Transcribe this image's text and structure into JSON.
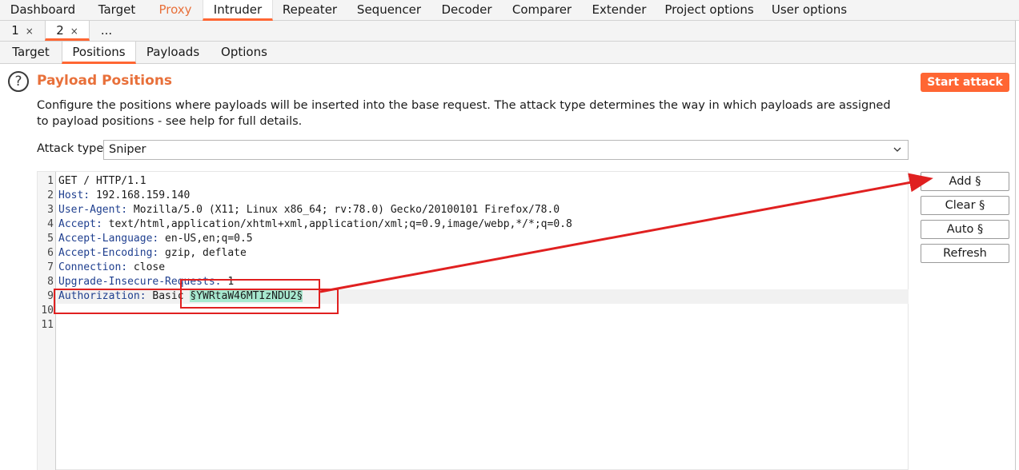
{
  "tool_tabs": [
    "Dashboard",
    "Target",
    "Proxy",
    "Intruder",
    "Repeater",
    "Sequencer",
    "Decoder",
    "Comparer",
    "Extender",
    "Project options",
    "User options"
  ],
  "num_tabs": [
    {
      "label": "1",
      "close": "×"
    },
    {
      "label": "2",
      "close": "×"
    },
    {
      "label": "..."
    }
  ],
  "sub_tabs": [
    "Target",
    "Positions",
    "Payloads",
    "Options"
  ],
  "section": {
    "title": "Payload Positions",
    "description": "Configure the positions where payloads will be inserted into the base request. The attack type determines the way in which payloads are assigned to payload positions - see help for full details.",
    "start_attack": "Start attack"
  },
  "attack_type": {
    "label": "Attack type:",
    "value": "Sniper"
  },
  "request": {
    "line_numbers": [
      "1",
      "2",
      "3",
      "4",
      "5",
      "6",
      "7",
      "8",
      "9",
      "10",
      "11"
    ],
    "request_line": "GET / HTTP/1.1",
    "headers": [
      {
        "key": "Host:",
        "value": " 192.168.159.140"
      },
      {
        "key": "User-Agent:",
        "value": " Mozilla/5.0 (X11; Linux x86_64; rv:78.0) Gecko/20100101 Firefox/78.0"
      },
      {
        "key": "Accept:",
        "value": " text/html,application/xhtml+xml,application/xml;q=0.9,image/webp,*/*;q=0.8"
      },
      {
        "key": "Accept-Language:",
        "value": " en-US,en;q=0.5"
      },
      {
        "key": "Accept-Encoding:",
        "value": " gzip, deflate"
      },
      {
        "key": "Connection:",
        "value": " close"
      },
      {
        "key": "Upgrade-Insecure-Requests:",
        "value": " 1"
      }
    ],
    "auth": {
      "key": "Authorization:",
      "value": " Basic ",
      "payload": "§YWRtaW46MTIzNDU2§"
    }
  },
  "side_buttons": {
    "add": "Add §",
    "clear": "Clear §",
    "auto": "Auto §",
    "refresh": "Refresh"
  },
  "colors": {
    "accent": "#ff6633",
    "payload_highlight": "#a7e8cf",
    "annotation": "#e02020"
  }
}
